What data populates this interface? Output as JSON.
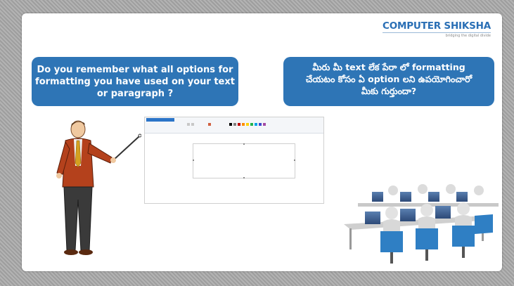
{
  "logo": {
    "brand": "COMPUTER SHIKSHA",
    "tagline": "bridging the digital divide"
  },
  "question_en": {
    "line1": "Do you remember what all options for",
    "line2": "formatting  you have used on your text",
    "line3": "or paragraph ?"
  },
  "question_te": {
    "line1": "మీరు మీ text లేక పేరా లో formatting",
    "line2": "చేయటం కోసం ఏ option లని ఉపయోగించారో",
    "line3": "మీకు గుర్తుందా?"
  },
  "colors": {
    "bubble": "#2e75b6",
    "logo_blue": "#2a6fb5",
    "slide_bg": "#ffffff",
    "frame": "#a9a9a9"
  },
  "images": {
    "teacher": "teacher-pointing-illustration",
    "screenshot": "paint-app-window-thumbnail",
    "lab": "computer-lab-illustration"
  }
}
